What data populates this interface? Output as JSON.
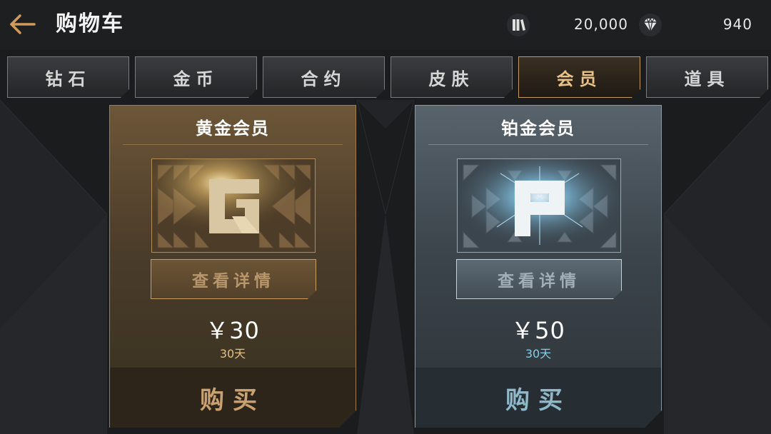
{
  "header": {
    "title": "购物车",
    "coins": "20,000",
    "gems": "940"
  },
  "tabs": [
    {
      "label": "钻石",
      "active": false
    },
    {
      "label": "金币",
      "active": false
    },
    {
      "label": "合约",
      "active": false
    },
    {
      "label": "皮肤",
      "active": false
    },
    {
      "label": "会员",
      "active": true
    },
    {
      "label": "道具",
      "active": false
    }
  ],
  "cards": [
    {
      "title": "黄金会员",
      "emblem_letter": "G",
      "details_label": "查看详情",
      "price": "￥30",
      "duration": "30天",
      "buy_label": "购买"
    },
    {
      "title": "铂金会员",
      "emblem_letter": "P",
      "details_label": "查看详情",
      "price": "￥50",
      "duration": "30天",
      "buy_label": "购买"
    }
  ],
  "colors": {
    "accent_gold": "#c49a62",
    "accent_platinum": "#86cde6",
    "background": "#1b1c1e"
  },
  "icons": {
    "back": "arrow-left-icon",
    "coins": "books-icon",
    "gems": "diamond-icon"
  }
}
